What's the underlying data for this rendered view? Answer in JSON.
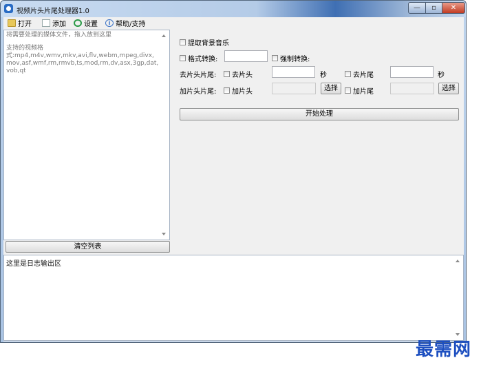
{
  "window": {
    "title": "视频片头片尾处理器1.0",
    "controls": {
      "minimize": "—",
      "maximize": "▫",
      "close": "✕"
    }
  },
  "menu": {
    "open": "打开",
    "add": "添加",
    "settings": "设置",
    "help": "帮助/支持"
  },
  "file_list": {
    "placeholder_line1": "将需要处理的媒体文件，拖入放到这里",
    "supported_label": "支持的视频格",
    "supported_formats": "式:mp4,m4v,wmv,mkv,avi,flv,webm,mpeg,divx,mov,asf,wmf,rm,rmvb,ts,mod,rm,dv,asx,3gp,dat,vob,qt",
    "clear_button": "清空列表"
  },
  "options": {
    "extract_bgm": "提取背景音乐",
    "format_convert": "格式转换:",
    "force_convert": "强制转换:",
    "remove_label": "去片头片尾:",
    "remove_head": "去片头",
    "remove_tail": "去片尾",
    "seconds_unit": "秒",
    "add_label": "加片头片尾:",
    "add_head": "加片头",
    "add_tail": "加片尾",
    "select_button": "选择",
    "start_button": "开始处理"
  },
  "log": {
    "text": "这里是日志输出区"
  },
  "watermark": "最需网"
}
